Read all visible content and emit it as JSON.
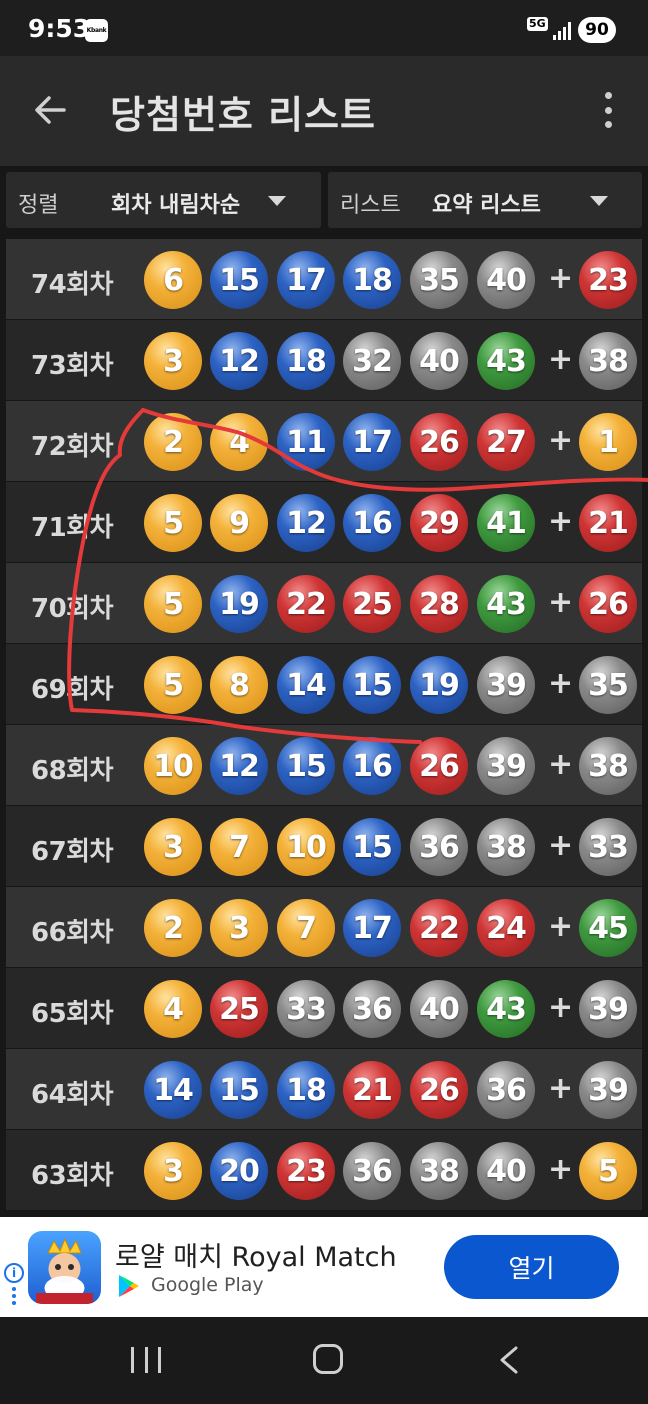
{
  "status_bar": {
    "time": "9:53",
    "kbank_label": "Kbank",
    "network": "5G",
    "battery": "90"
  },
  "app_bar": {
    "title": "당첨번호 리스트"
  },
  "filters": {
    "sort_label": "정렬",
    "sort_value": "회차 내림차순",
    "list_label": "리스트",
    "list_value": "요약 리스트"
  },
  "ball_colors": {
    "yellow": "#f4b23a",
    "blue": "#2d63c4",
    "red": "#cf3535",
    "gray": "#8a8a8a",
    "green": "#3f9a3f"
  },
  "plus": "+",
  "draws": [
    {
      "round": "74회차",
      "numbers": [
        "6",
        "15",
        "17",
        "18",
        "35",
        "40"
      ],
      "bonus": "23"
    },
    {
      "round": "73회차",
      "numbers": [
        "3",
        "12",
        "18",
        "32",
        "40",
        "43"
      ],
      "bonus": "38"
    },
    {
      "round": "72회차",
      "numbers": [
        "2",
        "4",
        "11",
        "17",
        "26",
        "27"
      ],
      "bonus": "1"
    },
    {
      "round": "71회차",
      "numbers": [
        "5",
        "9",
        "12",
        "16",
        "29",
        "41"
      ],
      "bonus": "21"
    },
    {
      "round": "70회차",
      "numbers": [
        "5",
        "19",
        "22",
        "25",
        "28",
        "43"
      ],
      "bonus": "26"
    },
    {
      "round": "69회차",
      "numbers": [
        "5",
        "8",
        "14",
        "15",
        "19",
        "39"
      ],
      "bonus": "35"
    },
    {
      "round": "68회차",
      "numbers": [
        "10",
        "12",
        "15",
        "16",
        "26",
        "39"
      ],
      "bonus": "38"
    },
    {
      "round": "67회차",
      "numbers": [
        "3",
        "7",
        "10",
        "15",
        "36",
        "38"
      ],
      "bonus": "33"
    },
    {
      "round": "66회차",
      "numbers": [
        "2",
        "3",
        "7",
        "17",
        "22",
        "24"
      ],
      "bonus": "45"
    },
    {
      "round": "65회차",
      "numbers": [
        "4",
        "25",
        "33",
        "36",
        "40",
        "43"
      ],
      "bonus": "39"
    },
    {
      "round": "64회차",
      "numbers": [
        "14",
        "15",
        "18",
        "21",
        "26",
        "36"
      ],
      "bonus": "39"
    },
    {
      "round": "63회차",
      "numbers": [
        "3",
        "20",
        "23",
        "36",
        "38",
        "40"
      ],
      "bonus": "5"
    }
  ],
  "ad": {
    "title": "로얄 매치 Royal Match",
    "store": "Google Play",
    "open_label": "열기"
  }
}
